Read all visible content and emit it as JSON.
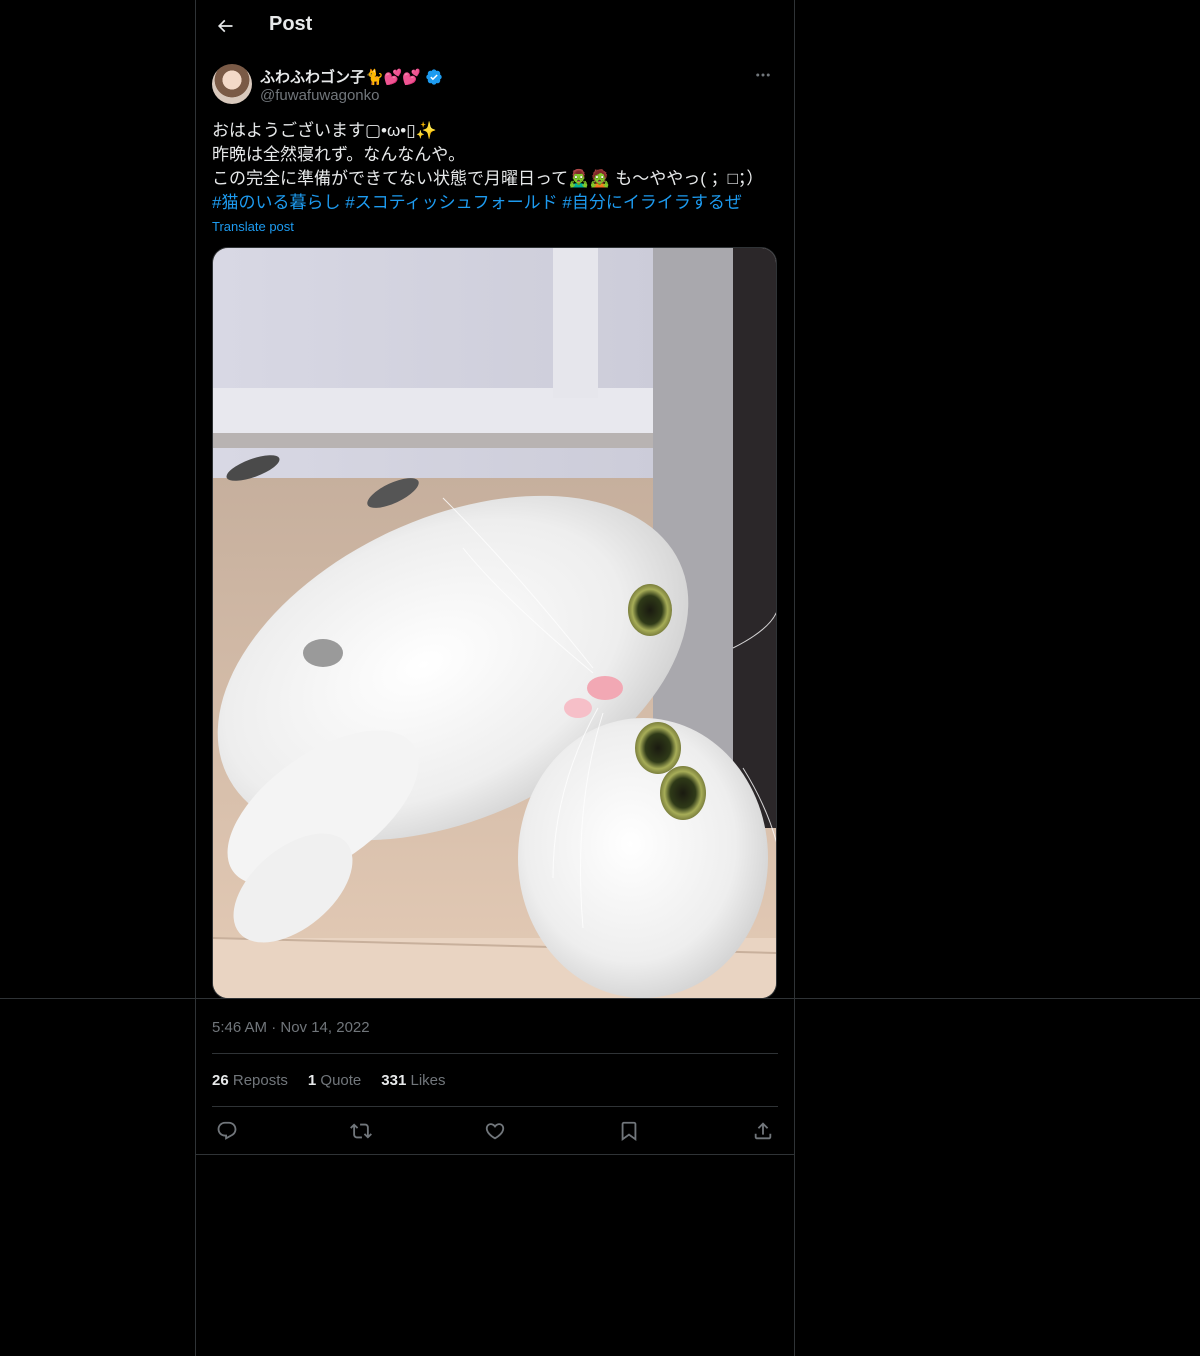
{
  "header": {
    "title": "Post",
    "back_icon": "arrow-left-icon"
  },
  "author": {
    "display_name": "ふわふわゴン子🐈💕💕",
    "handle": "@fuwafuwagonko",
    "verified": true,
    "verified_color": "#1d9bf0"
  },
  "post": {
    "lines": [
      "おはようございます▢•ω•▯✨",
      "昨晩は全然寝れず。なんなんや。",
      "この完全に準備ができてない状態で月曜日って🧟‍♂️🧟 も〜ややっ( ；□；）"
    ],
    "hashtags": [
      "#猫のいる暮らし",
      "#スコティッシュフォールド",
      "#自分にイライラするぜ"
    ],
    "translate_label": "Translate post",
    "timestamp": "5:46 AM · Nov 14, 2022"
  },
  "stats": {
    "reposts_count": "26",
    "reposts_label": "Reposts",
    "quotes_count": "1",
    "quotes_label": "Quote",
    "likes_count": "331",
    "likes_label": "Likes"
  },
  "actions": [
    "reply-icon",
    "repost-icon",
    "like-icon",
    "bookmark-icon",
    "share-icon"
  ],
  "colors": {
    "background": "#000000",
    "text": "#e7e9ea",
    "secondary": "#71767b",
    "accent": "#1d9bf0",
    "border": "#2f3336"
  }
}
